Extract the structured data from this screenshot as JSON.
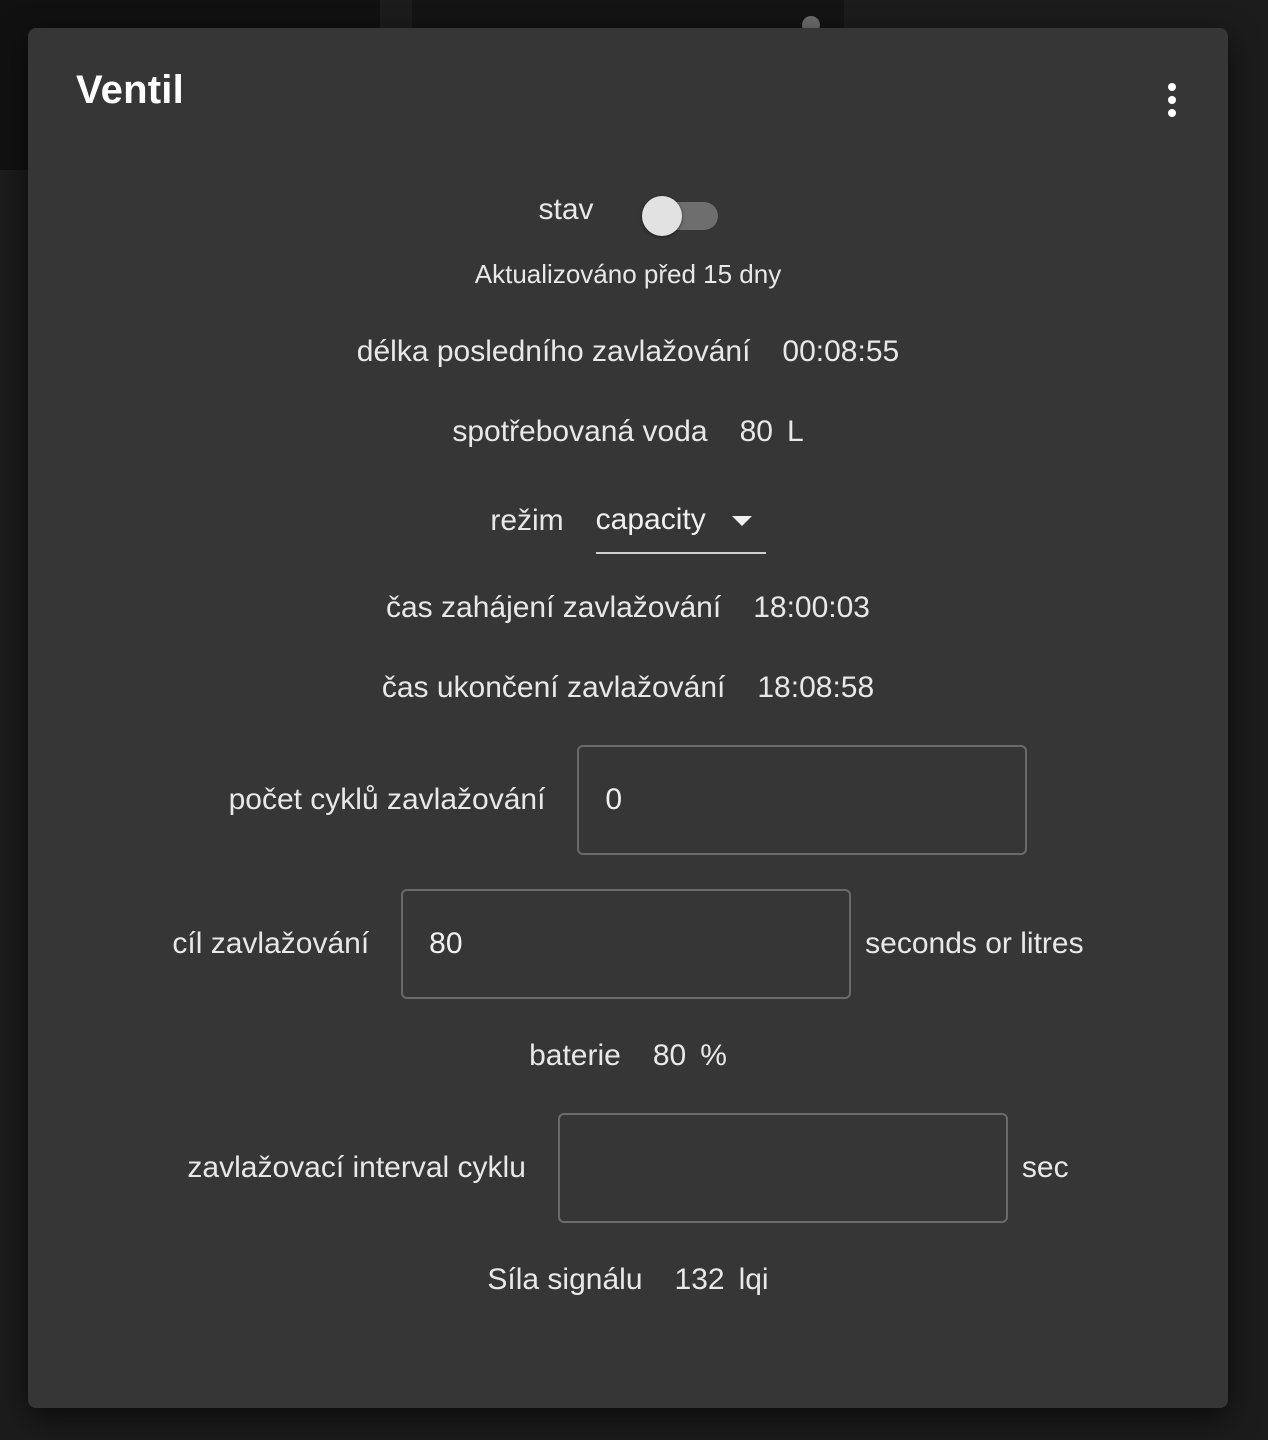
{
  "dialog": {
    "title": "Ventil",
    "menu_icon": "more-vertical-icon"
  },
  "state": {
    "label": "stav",
    "toggle_on": false,
    "updated": "Aktualizováno před 15 dny"
  },
  "last_duration": {
    "label": "délka posledního zavlažování",
    "value": "00:08:55"
  },
  "water_used": {
    "label": "spotřebovaná voda",
    "value": "80",
    "unit": "L"
  },
  "mode": {
    "label": "režim",
    "value": "capacity"
  },
  "start_time": {
    "label": "čas zahájení zavlažování",
    "value": "18:00:03"
  },
  "end_time": {
    "label": "čas ukončení zavlažování",
    "value": "18:08:58"
  },
  "cycles": {
    "label": "počet cyklů zavlažování",
    "value": "0"
  },
  "target": {
    "label": "cíl zavlažování",
    "value": "80",
    "unit": "seconds or litres"
  },
  "battery": {
    "label": "baterie",
    "value": "80",
    "unit": "%"
  },
  "cycle_interval": {
    "label": "zavlažovací interval cyklu",
    "value": "",
    "unit": "sec"
  },
  "signal": {
    "label": "Síla signálu",
    "value": "132",
    "unit": "lqi"
  },
  "colors": {
    "dialog_bg": "#363636",
    "page_bg": "#1c1c1c",
    "text": "#e8e8e8",
    "field_border": "#6a6a6a"
  }
}
